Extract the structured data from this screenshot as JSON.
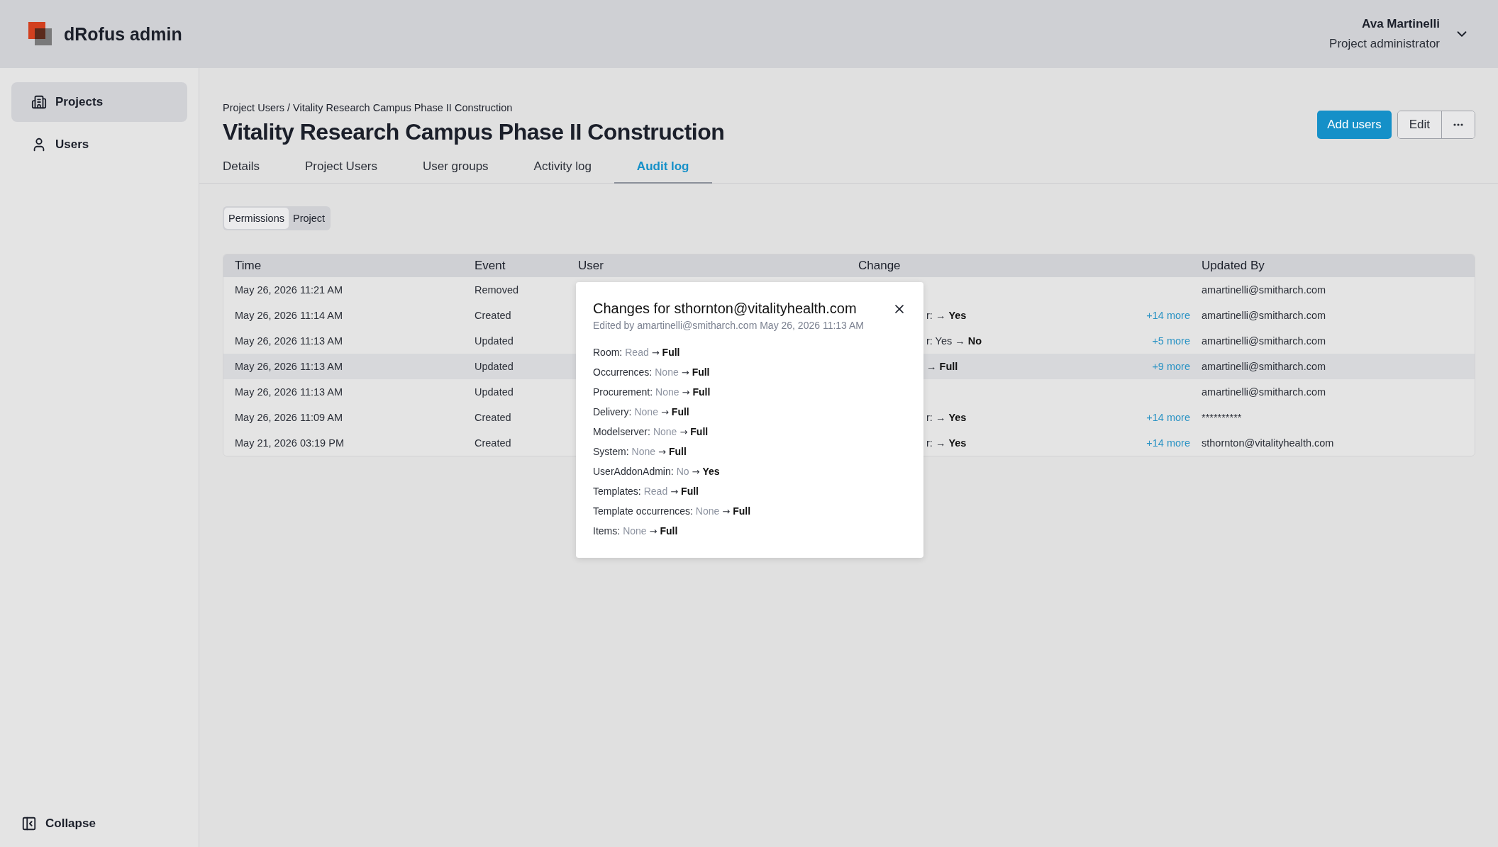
{
  "app": {
    "title": "dRofus admin"
  },
  "user_menu": {
    "name": "Ava Martinelli",
    "role": "Project administrator"
  },
  "sidebar": {
    "items": [
      {
        "label": "Projects",
        "selected": true
      },
      {
        "label": "Users",
        "selected": false
      }
    ],
    "collapse": "Collapse"
  },
  "breadcrumb": "Project Users / Vitality Research Campus Phase II Construction",
  "page_title": "Vitality Research Campus Phase II Construction",
  "actions": {
    "primary": "Add users",
    "secondary": "Edit"
  },
  "tabs": [
    {
      "label": "Details",
      "selected": false
    },
    {
      "label": "Project Users",
      "selected": false
    },
    {
      "label": "User groups",
      "selected": false
    },
    {
      "label": "Activity log",
      "selected": false
    },
    {
      "label": "Audit log",
      "selected": true
    }
  ],
  "segments": [
    {
      "label": "Permissions",
      "selected": true
    },
    {
      "label": "Project",
      "selected": false
    }
  ],
  "table": {
    "columns": [
      "Time",
      "Event",
      "User",
      "Change",
      "Updated By"
    ],
    "rows": [
      {
        "time": "May 26, 2026 11:21 AM",
        "event": "Removed",
        "updated_by": "amartinelli@smitharch.com",
        "highlighted": false
      },
      {
        "time": "May 26, 2026 11:14 AM",
        "event": "Created",
        "change": "r: → **Yes**",
        "more": "+14 more",
        "updated_by": "amartinelli@smitharch.com",
        "highlighted": false
      },
      {
        "time": "May 26, 2026 11:13 AM",
        "event": "Updated",
        "change": "r: Yes → **No**",
        "more": "+5 more",
        "updated_by": "amartinelli@smitharch.com",
        "highlighted": false
      },
      {
        "time": "May 26, 2026 11:13 AM",
        "event": "Updated",
        "change": "→ **Full**",
        "more": "+9 more",
        "updated_by": "amartinelli@smitharch.com",
        "highlighted": true
      },
      {
        "time": "May 26, 2026 11:13 AM",
        "event": "Updated",
        "updated_by": "amartinelli@smitharch.com",
        "highlighted": false
      },
      {
        "time": "May 26, 2026 11:09 AM",
        "event": "Created",
        "change": "r: → **Yes**",
        "more": "+14 more",
        "updated_by": "**********",
        "highlighted": false
      },
      {
        "time": "May 21, 2026 03:19 PM",
        "event": "Created",
        "change": "r: → **Yes**",
        "more": "+14 more",
        "updated_by": "sthornton@vitalityhealth.com",
        "highlighted": false
      }
    ]
  },
  "popup": {
    "title": "Changes for sthornton@vitalityhealth.com",
    "subtitle": "Edited by amartinelli@smitharch.com May 26, 2026 11:13 AM",
    "changes": [
      {
        "field": "Room:",
        "from": "Read",
        "arrow": "→",
        "to": "Full"
      },
      {
        "field": "Occurrences:",
        "from": "None",
        "arrow": "→",
        "to": "Full"
      },
      {
        "field": "Procurement:",
        "from": "None",
        "arrow": "→",
        "to": "Full"
      },
      {
        "field": "Delivery:",
        "from": "None",
        "arrow": "→",
        "to": "Full"
      },
      {
        "field": "Modelserver:",
        "from": "None",
        "arrow": "→",
        "to": "Full"
      },
      {
        "field": "System:",
        "from": "None",
        "arrow": "→",
        "to": "Full"
      },
      {
        "field": "UserAddonAdmin:",
        "from": "No",
        "arrow": "→",
        "to": "Yes"
      },
      {
        "field": "Templates:",
        "from": "Read",
        "arrow": "→",
        "to": "Full"
      },
      {
        "field": "Template occurrences:",
        "from": "None",
        "arrow": "→",
        "to": "Full"
      },
      {
        "field": "Items:",
        "from": "None",
        "arrow": "→",
        "to": "Full"
      }
    ]
  }
}
